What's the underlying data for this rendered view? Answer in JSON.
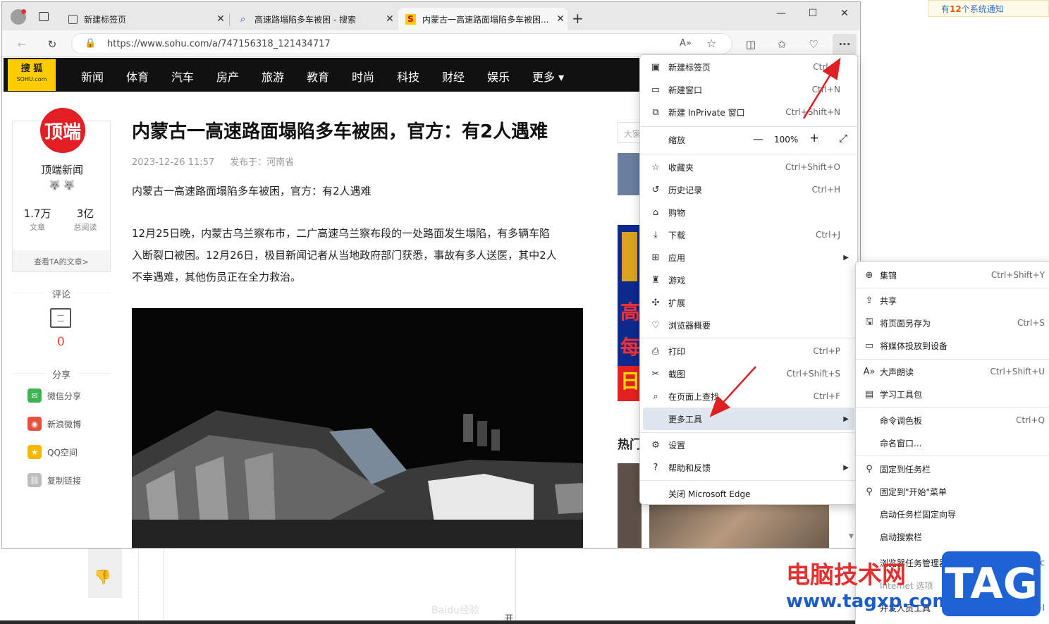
{
  "background": {
    "notice_prefix": "有",
    "notice_count": "12",
    "notice_suffix": "个系统通知",
    "baidu_watermark": "Baidu经验",
    "bottom_text": "开"
  },
  "tabs": [
    {
      "title": "新建标签页",
      "icon": "new-tab-icon"
    },
    {
      "title": "高速路塌陷多车被困 - 搜索",
      "icon": "search-icon"
    },
    {
      "title": "内蒙古一高速路面塌陷多车被困...",
      "icon": "sohu-favicon"
    }
  ],
  "address": {
    "url": "https://www.sohu.com/a/747156318_121434717"
  },
  "nav": {
    "logo_top": "搜 狐",
    "logo_bottom": "SOHU.com",
    "items": [
      "新闻",
      "体育",
      "汽车",
      "房产",
      "旅游",
      "教育",
      "时尚",
      "科技",
      "财经",
      "娱乐",
      "更多 ▾"
    ]
  },
  "author": {
    "avatar_text": "顶端",
    "name": "顶端新闻",
    "badges": "🐺 🐺",
    "articles_value": "1.7万",
    "articles_label": "文章",
    "reads_value": "3亿",
    "reads_label": "总阅读",
    "more_link": "查看TA的文章>"
  },
  "comments": {
    "heading": "评论",
    "count": "0"
  },
  "share": {
    "heading": "分享",
    "items": [
      {
        "label": "微信分享",
        "color": "#3fb34f"
      },
      {
        "label": "新浪微博",
        "color": "#e6503c"
      },
      {
        "label": "QQ空间",
        "color": "#f5b800"
      },
      {
        "label": "复制链接",
        "color": "#bdbdbd"
      }
    ]
  },
  "article": {
    "title": "内蒙古一高速路面塌陷多车被困，官方：有2人遇难",
    "date": "2023-12-26 11:57",
    "source": "发布于：河南省",
    "lead": "内蒙古一高速路面塌陷多车被困，官方：有2人遇难",
    "p1": "12月25日晚，内蒙古乌兰察布市，二广高速乌兰察布段的一处路面发生塌陷，有多辆车陷",
    "p2": "入断裂口被困。12月26日，极目新闻记者从当地政府部门获悉，事故有多人送医，其中2人",
    "p3": "不幸遇难，其他伤员正在全力救治。"
  },
  "right": {
    "search_placeholder": "大家",
    "hot_heading": "热门",
    "ad_chars": [
      "高",
      "每",
      "日"
    ]
  },
  "menu": {
    "items": [
      {
        "label": "新建标签页",
        "shortcut": "Ctrl+T",
        "icon": "new-tab-icon"
      },
      {
        "label": "新建窗口",
        "shortcut": "Ctrl+N",
        "icon": "window-icon"
      },
      {
        "label": "新建 InPrivate 窗口",
        "shortcut": "Ctrl+Shift+N",
        "icon": "inprivate-icon"
      },
      {
        "label": "缩放",
        "zoom": "100%",
        "icon": "none"
      },
      {
        "label": "收藏夹",
        "shortcut": "Ctrl+Shift+O",
        "icon": "star-list-icon"
      },
      {
        "label": "历史记录",
        "shortcut": "Ctrl+H",
        "icon": "history-icon"
      },
      {
        "label": "购物",
        "shortcut": "",
        "icon": "tag-icon"
      },
      {
        "label": "下载",
        "shortcut": "Ctrl+J",
        "icon": "download-icon"
      },
      {
        "label": "应用",
        "shortcut": "",
        "icon": "apps-icon"
      },
      {
        "label": "游戏",
        "shortcut": "",
        "icon": "games-icon"
      },
      {
        "label": "扩展",
        "shortcut": "",
        "icon": "extensions-icon"
      },
      {
        "label": "浏览器概要",
        "shortcut": "",
        "icon": "heart-pulse-icon"
      },
      {
        "label": "打印",
        "shortcut": "Ctrl+P",
        "icon": "print-icon"
      },
      {
        "label": "截图",
        "shortcut": "Ctrl+Shift+S",
        "icon": "screenshot-icon"
      },
      {
        "label": "在页面上查找",
        "shortcut": "Ctrl+F",
        "icon": "find-icon"
      },
      {
        "label": "更多工具",
        "shortcut": "",
        "icon": "none"
      },
      {
        "label": "设置",
        "shortcut": "",
        "icon": "gear-icon"
      },
      {
        "label": "帮助和反馈",
        "shortcut": "",
        "icon": "help-icon"
      },
      {
        "label": "关闭 Microsoft Edge",
        "shortcut": "",
        "icon": "none"
      }
    ]
  },
  "submenu": {
    "items": [
      {
        "label": "集锦",
        "shortcut": "Ctrl+Shift+Y"
      },
      {
        "label": "共享",
        "shortcut": ""
      },
      {
        "label": "将页面另存为",
        "shortcut": "Ctrl+S"
      },
      {
        "label": "将媒体投放到设备",
        "shortcut": ""
      },
      {
        "label": "大声朗读",
        "shortcut": "Ctrl+Shift+U"
      },
      {
        "label": "学习工具包",
        "shortcut": ""
      },
      {
        "label": "命令调色板",
        "shortcut": "Ctrl+Q"
      },
      {
        "label": "命名窗口...",
        "shortcut": ""
      },
      {
        "label": "固定到任务栏",
        "shortcut": ""
      },
      {
        "label": "固定到\"开始\"菜单",
        "shortcut": ""
      },
      {
        "label": "启动任务栏固定向导",
        "shortcut": ""
      },
      {
        "label": "启动搜索栏",
        "shortcut": ""
      },
      {
        "label": "浏览器任务管理器",
        "shortcut": "Shift+Esc"
      },
      {
        "label": "Internet 选项",
        "shortcut": ""
      },
      {
        "label": "开发人员工具",
        "shortcut": "Ctrl+Shift+I"
      }
    ]
  },
  "watermark": {
    "line1": "电脑技术网",
    "line2": "www.tagxp.com",
    "tag": "TAG"
  },
  "colors": {
    "accent_red": "#e53030",
    "sohu_yellow": "#ffcc00",
    "tag_blue": "#1e63d6"
  }
}
